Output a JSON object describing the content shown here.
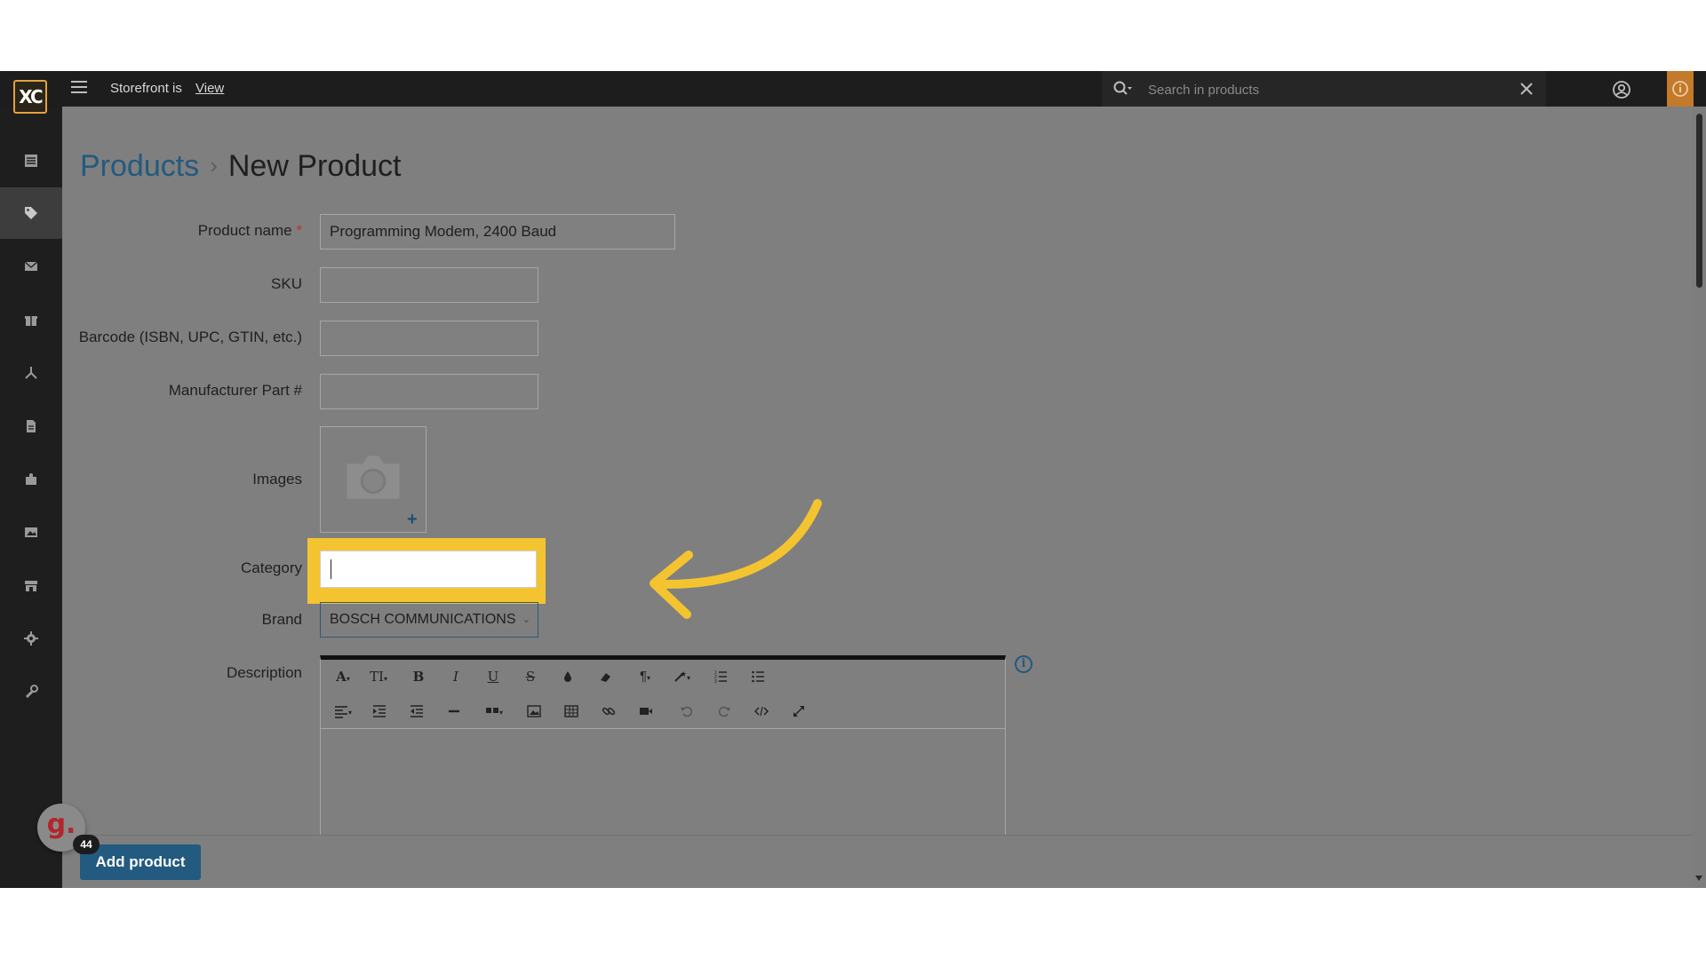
{
  "topbar": {
    "logo_text": "XC",
    "storefront_text": "Storefront is",
    "storefront_link": "View",
    "search_placeholder": "Search in products"
  },
  "sidebar": {
    "items": [
      {
        "name": "orders-icon"
      },
      {
        "name": "products-tag-icon",
        "active": true
      },
      {
        "name": "mail-icon"
      },
      {
        "name": "gift-icon"
      },
      {
        "name": "sitemap-icon"
      },
      {
        "name": "pages-icon"
      },
      {
        "name": "addons-puzzle-icon"
      },
      {
        "name": "images-icon"
      },
      {
        "name": "store-icon"
      },
      {
        "name": "settings-gear-icon"
      },
      {
        "name": "tools-wrench-icon"
      }
    ]
  },
  "breadcrumb": {
    "parent": "Products",
    "separator": "›",
    "current": "New Product"
  },
  "form": {
    "product_name_label": "Product name",
    "required_mark": "*",
    "product_name_value": "Programming Modem, 2400 Baud",
    "sku_label": "SKU",
    "barcode_label": "Barcode (ISBN, UPC, GTIN, etc.)",
    "mpn_label": "Manufacturer Part #",
    "images_label": "Images",
    "images_add": "+",
    "category_label": "Category",
    "brand_label": "Brand",
    "brand_value": "BOSCH COMMUNICATIONS",
    "description_label": "Description"
  },
  "editor_toolbar": {
    "row1": [
      "A▾",
      "TI▾",
      "B",
      "I",
      "U",
      "S",
      "color-drop-icon",
      "eraser-icon",
      "¶▾",
      "magic-icon▾",
      "ordered-list-icon",
      "unordered-list-icon"
    ],
    "row2": [
      "align-icon▾",
      "indent-icon",
      "outdent-icon",
      "—",
      "quote-icon▾",
      "image-icon",
      "table-icon",
      "link-icon",
      "video-icon",
      "undo-icon",
      "redo-icon",
      "code-icon",
      "fullscreen-icon"
    ]
  },
  "footer": {
    "add_button": "Add product"
  },
  "badge": {
    "letter": "g.",
    "count": "44"
  },
  "colors": {
    "accent": "#235a7f",
    "highlight": "#f4c430",
    "topbar": "#1d1d1d",
    "overlay": "#7f7f7f"
  }
}
